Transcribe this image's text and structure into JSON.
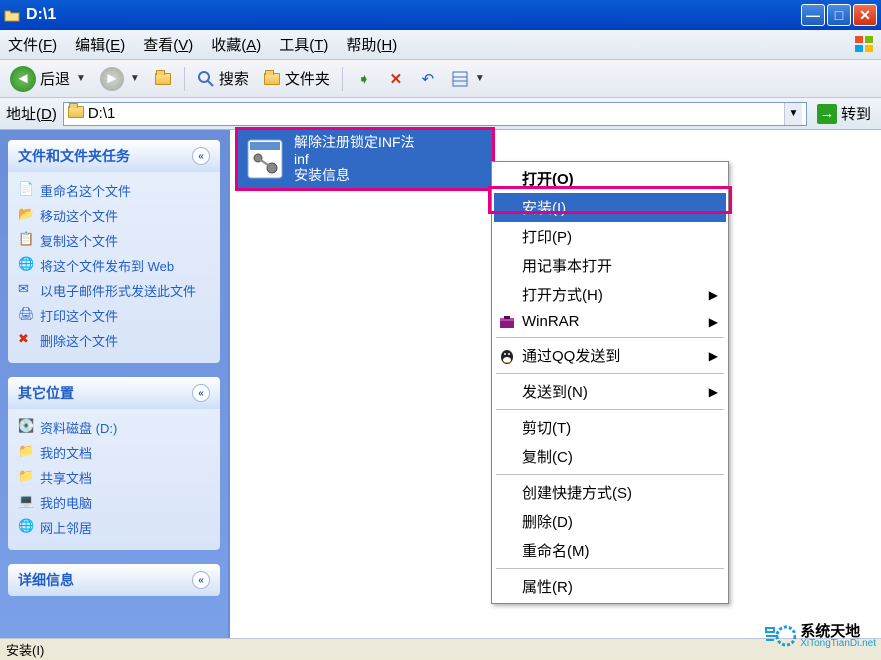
{
  "window": {
    "title": "D:\\1"
  },
  "menu": {
    "file": "文件(F)",
    "edit": "编辑(E)",
    "view": "查看(V)",
    "favorites": "收藏(A)",
    "tools": "工具(T)",
    "help": "帮助(H)"
  },
  "toolbar": {
    "back": "后退",
    "search": "搜索",
    "folders": "文件夹"
  },
  "address": {
    "label": "地址(D)",
    "value": "D:\\1",
    "go": "转到"
  },
  "sidebar": {
    "tasks": {
      "title": "文件和文件夹任务",
      "items": [
        "重命名这个文件",
        "移动这个文件",
        "复制这个文件",
        "将这个文件发布到 Web",
        "以电子邮件形式发送此文件",
        "打印这个文件",
        "删除这个文件"
      ]
    },
    "places": {
      "title": "其它位置",
      "items": [
        "资料磁盘 (D:)",
        "我的文档",
        "共享文档",
        "我的电脑",
        "网上邻居"
      ]
    },
    "details": {
      "title": "详细信息"
    }
  },
  "file": {
    "line1": "解除注册锁定INF法",
    "line2": "inf",
    "line3": "安装信息"
  },
  "context_menu": {
    "open": "打开(O)",
    "install": "安装(I)",
    "print": "打印(P)",
    "notepad": "用记事本打开",
    "open_with": "打开方式(H)",
    "winrar": "WinRAR",
    "qq_send": "通过QQ发送到",
    "send_to": "发送到(N)",
    "cut": "剪切(T)",
    "copy": "复制(C)",
    "shortcut": "创建快捷方式(S)",
    "delete": "删除(D)",
    "rename": "重命名(M)",
    "properties": "属性(R)"
  },
  "status": "安装(I)",
  "watermark": {
    "line1": "系统天地",
    "line2": "XiTongTianDi.net"
  }
}
